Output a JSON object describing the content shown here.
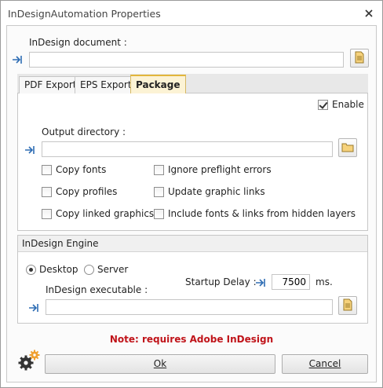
{
  "window": {
    "title": "InDesignAutomation Properties"
  },
  "document": {
    "label": "InDesign document :",
    "value": ""
  },
  "tabs": [
    {
      "label": "PDF Export"
    },
    {
      "label": "EPS Export"
    },
    {
      "label": "Package"
    }
  ],
  "package": {
    "enable_label": "Enable",
    "enable_checked": true,
    "output_label": "Output directory :",
    "output_value": "",
    "options_left": [
      "Copy fonts",
      "Copy profiles",
      "Copy linked graphics"
    ],
    "options_right": [
      "Ignore preflight errors",
      "Update graphic links",
      "Include fonts & links from hidden layers"
    ]
  },
  "engine": {
    "title": "InDesign Engine",
    "desktop_label": "Desktop",
    "server_label": "Server",
    "selected": "Desktop",
    "startup_label": "Startup Delay :",
    "startup_value": "7500",
    "startup_unit": "ms.",
    "exe_label": "InDesign executable :",
    "exe_value": ""
  },
  "note": "Note: requires Adobe InDesign",
  "buttons": {
    "ok": "Ok",
    "cancel": "Cancel"
  },
  "colors": {
    "note": "#c0141a",
    "accent_icon": "#f0a030",
    "tab_active": "#fcf3d5",
    "arrow": "#2e6db4"
  },
  "icons": [
    "close-icon",
    "arrow-to-field-icon",
    "document-browse-icon",
    "folder-browse-icon",
    "settings-gears-icon"
  ]
}
